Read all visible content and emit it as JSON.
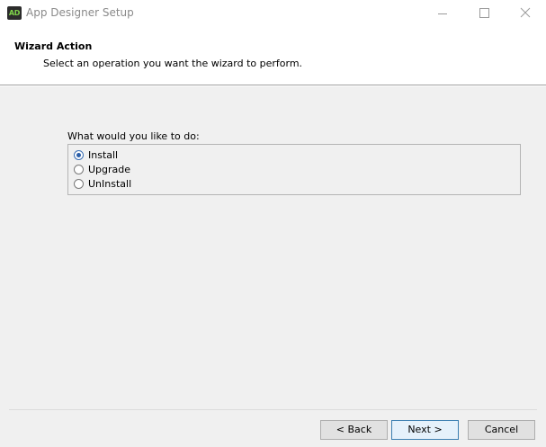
{
  "window": {
    "title": "App Designer Setup",
    "app_icon_text": "AD",
    "controls": [
      "minimize-icon",
      "maximize-icon",
      "close-icon"
    ]
  },
  "header": {
    "title": "Wizard Action",
    "subtitle": "Select an operation you want the wizard to perform."
  },
  "operation_group": {
    "label": "What would you like to do:",
    "options": [
      {
        "label": "Install",
        "selected": true
      },
      {
        "label": "Upgrade",
        "selected": false
      },
      {
        "label": "UnInstall",
        "selected": false
      }
    ]
  },
  "footer": {
    "back_label": "< Back",
    "next_label": "Next >",
    "cancel_label": "Cancel"
  },
  "colors": {
    "accent": "#3c7fb1",
    "header_bg": "#ffffff",
    "body_bg": "#f0f0f0",
    "app_icon_bg": "#2c2c2c",
    "app_icon_fg": "#7fd34a"
  }
}
